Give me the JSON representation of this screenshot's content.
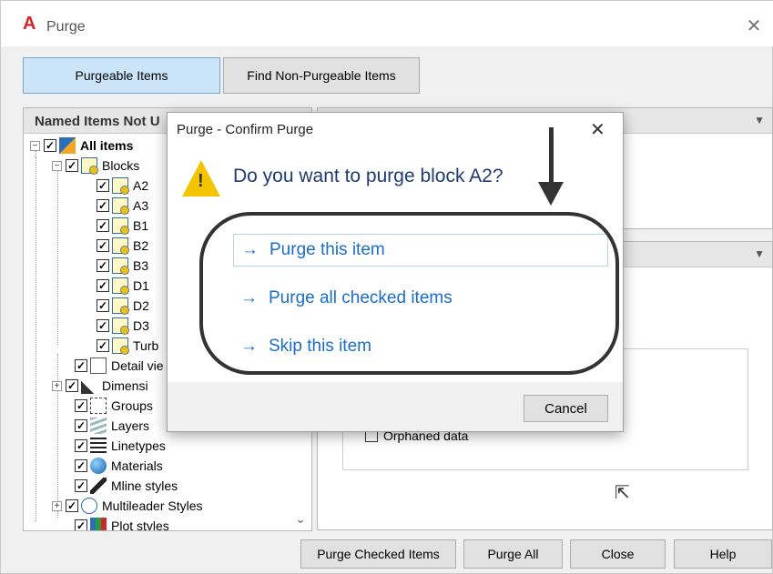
{
  "window": {
    "title": "Purge",
    "close_glyph": "✕",
    "app_icon": "autocad-logo-icon"
  },
  "tabs": [
    {
      "label": "Purgeable Items",
      "active": true
    },
    {
      "label": "Find Non-Purgeable Items",
      "active": false
    }
  ],
  "left_panel": {
    "header": "Named Items Not U",
    "tree": [
      {
        "label": "All items",
        "bold": true,
        "checked": true,
        "expander": "−",
        "icon": "all-items-icon",
        "indent": 0
      },
      {
        "label": "Blocks",
        "checked": true,
        "expander": "−",
        "icon": "block-icon",
        "indent": 1
      },
      {
        "label": "A2",
        "checked": true,
        "icon": "block-icon",
        "indent": 2
      },
      {
        "label": "A3",
        "checked": true,
        "icon": "block-icon",
        "indent": 2
      },
      {
        "label": "B1",
        "checked": true,
        "icon": "block-icon",
        "indent": 2
      },
      {
        "label": "B2",
        "checked": true,
        "icon": "block-icon",
        "indent": 2
      },
      {
        "label": "B3",
        "checked": true,
        "icon": "block-icon",
        "indent": 2
      },
      {
        "label": "D1",
        "checked": true,
        "icon": "block-icon",
        "indent": 2
      },
      {
        "label": "D2",
        "checked": true,
        "icon": "block-icon",
        "indent": 2
      },
      {
        "label": "D3",
        "checked": true,
        "icon": "block-icon",
        "indent": 2
      },
      {
        "label": "Turb",
        "checked": true,
        "icon": "block-icon",
        "indent": 2
      },
      {
        "label": "Detail vie",
        "checked": true,
        "icon": "detail-view-icon",
        "indent": 1
      },
      {
        "label": "Dimensi",
        "checked": true,
        "expander": "+",
        "icon": "dimension-icon",
        "indent": 1
      },
      {
        "label": "Groups",
        "checked": true,
        "icon": "groups-icon",
        "indent": 1
      },
      {
        "label": "Layers",
        "checked": true,
        "icon": "layers-icon",
        "indent": 1
      },
      {
        "label": "Linetypes",
        "checked": true,
        "icon": "linetypes-icon",
        "indent": 1
      },
      {
        "label": "Materials",
        "checked": true,
        "icon": "materials-icon",
        "indent": 1
      },
      {
        "label": "Mline styles",
        "checked": true,
        "icon": "mline-styles-icon",
        "indent": 1
      },
      {
        "label": "Multileader Styles",
        "checked": true,
        "expander": "+",
        "icon": "multileader-icon",
        "indent": 1
      },
      {
        "label": "Plot styles",
        "checked": true,
        "icon": "plot-styles-icon",
        "indent": 1
      }
    ],
    "scroll_glyph": "⌄"
  },
  "right_panel": {
    "orphaned_label": "Orphaned data",
    "orphaned_checked": false
  },
  "bottom_buttons": [
    "Purge Checked Items",
    "Purge All",
    "Close",
    "Help"
  ],
  "modal": {
    "title": "Purge - Confirm Purge",
    "close_glyph": "✕",
    "warning_glyph": "!",
    "question": "Do you want to purge block A2?",
    "options": [
      "Purge this item",
      "Purge all checked items",
      "Skip this item"
    ],
    "option_arrow": "→",
    "cancel_label": "Cancel"
  },
  "colors": {
    "link": "#1a6ec7",
    "question": "#1f3b73",
    "active_tab": "#cce4f7",
    "warning": "#f5c400"
  }
}
